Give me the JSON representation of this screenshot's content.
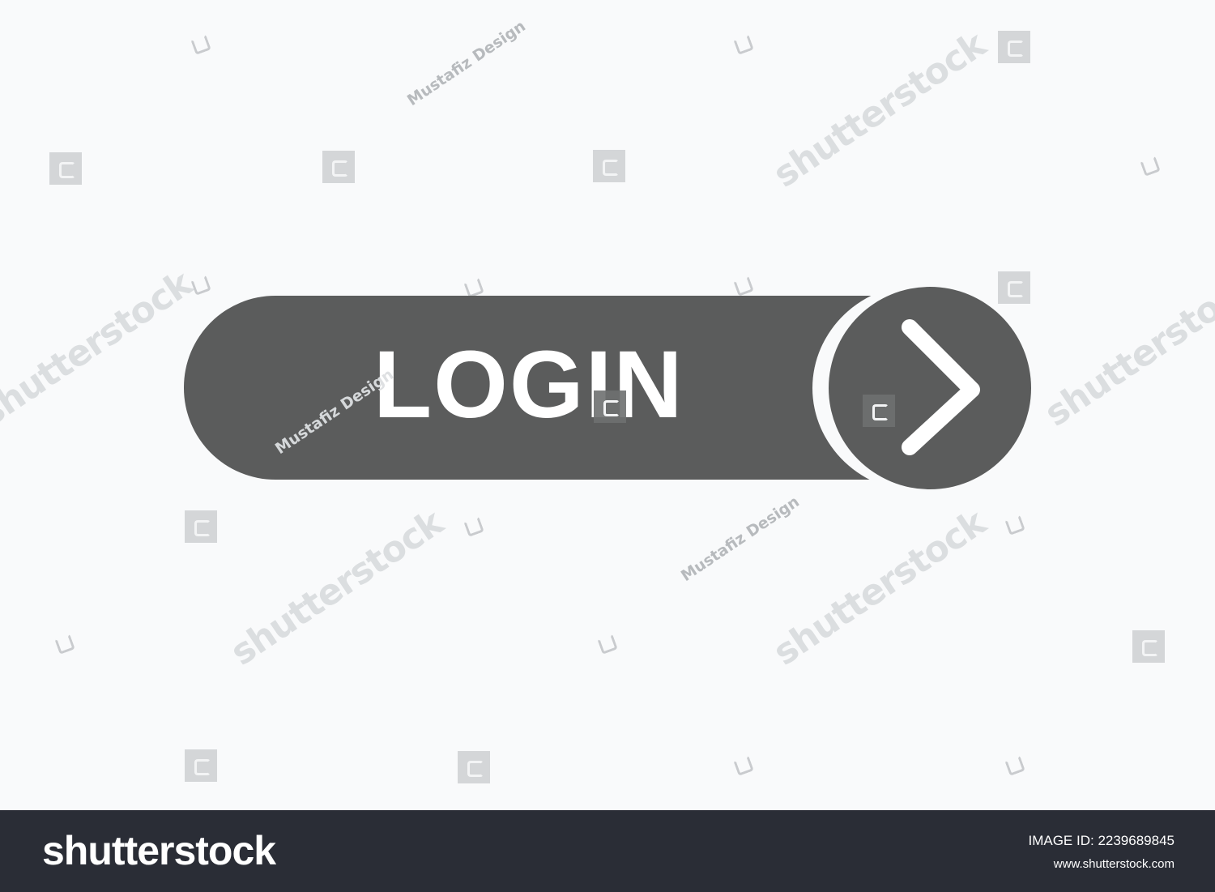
{
  "button": {
    "label": "LOGIN",
    "arrow_icon": "chevron-right-icon",
    "color": "#5b5c5c",
    "text_color": "#ffffff"
  },
  "watermarks": {
    "stock": "shutterstock",
    "author": "Mustafiz Design"
  },
  "footer": {
    "brand": "shutterstock",
    "image_id_label": "IMAGE ID: 2239689845",
    "url": "www.shutterstock.com",
    "background": "#2a2d36"
  }
}
